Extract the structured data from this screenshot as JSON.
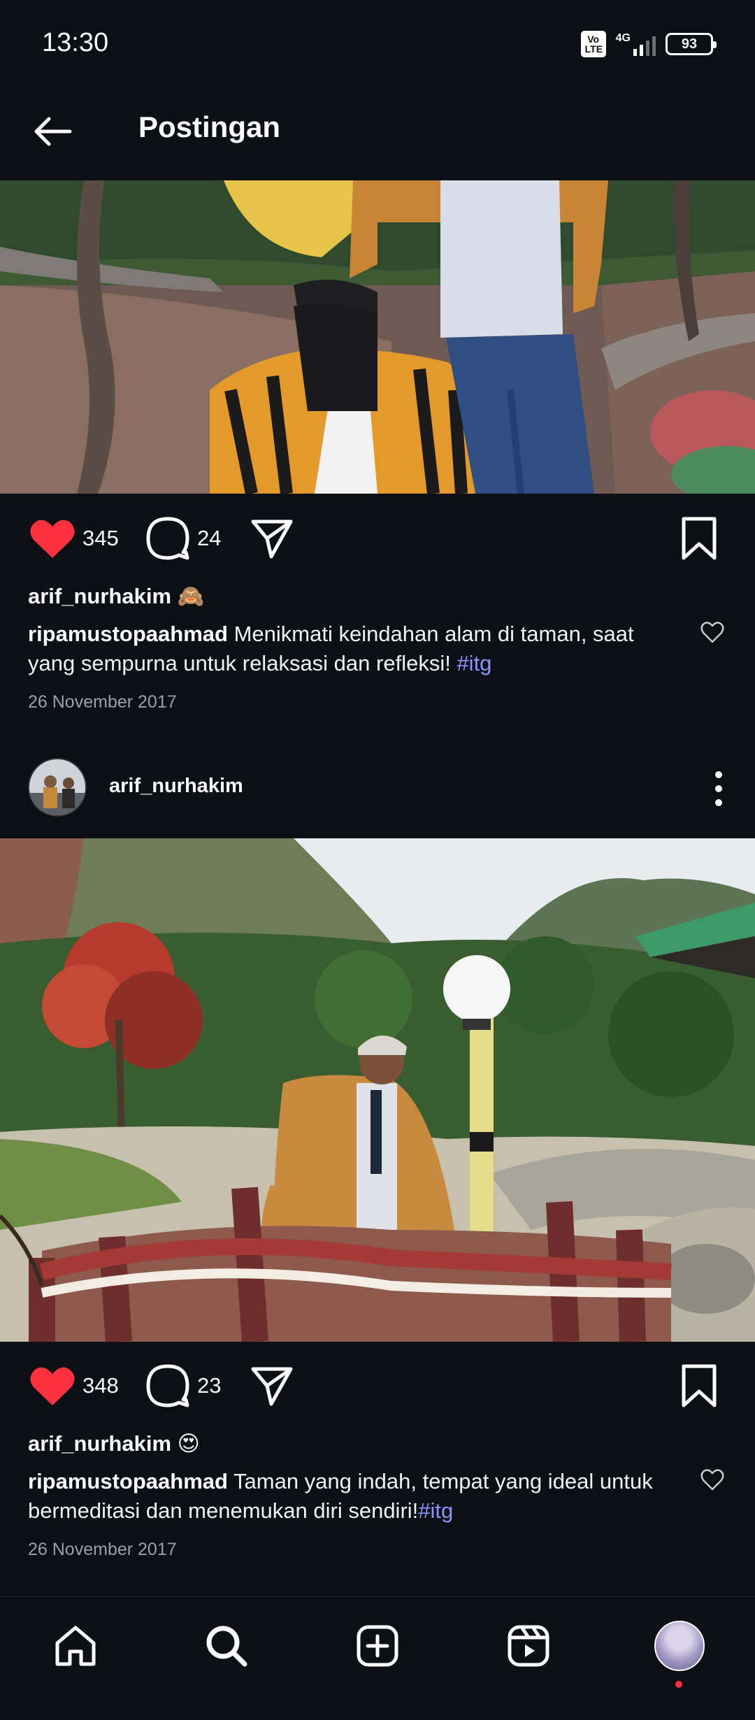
{
  "status_bar": {
    "time": "13:30",
    "volte_label": "Vo LTE",
    "network_label": "4G",
    "battery_level": "93"
  },
  "header": {
    "title": "Postingan",
    "back_icon": "arrow-left-icon"
  },
  "posts": [
    {
      "likes": "345",
      "comments": "24",
      "liked": true,
      "liker": "arif_nurhakim",
      "liker_emoji": "🙈",
      "caption_user": "ripamustopaahmad",
      "caption_line1": "Menikmati keindahan alam di taman, saat",
      "caption_line2": "yang sempurna untuk relaksasi dan refleksi! ",
      "hashtag": "#itg",
      "date": "26 November 2017"
    },
    {
      "author": "arif_nurhakim",
      "likes": "348",
      "comments": "23",
      "liked": true,
      "liker": "arif_nurhakim",
      "liker_emoji": "😍",
      "caption_user": "ripamustopaahmad",
      "caption_line1": "Taman yang indah, tempat yang ideal untuk",
      "caption_line2": "bermeditasi dan menemukan diri sendiri!",
      "hashtag": "#itg",
      "date": "26 November 2017"
    }
  ],
  "colors": {
    "background": "#0c0f14",
    "like_red": "#ff3040",
    "hashtag": "#8a96ff",
    "muted_text": "#9ba0a8"
  },
  "bottom_nav": [
    "home-icon",
    "search-icon",
    "create-post-icon",
    "reels-icon",
    "profile-avatar"
  ]
}
